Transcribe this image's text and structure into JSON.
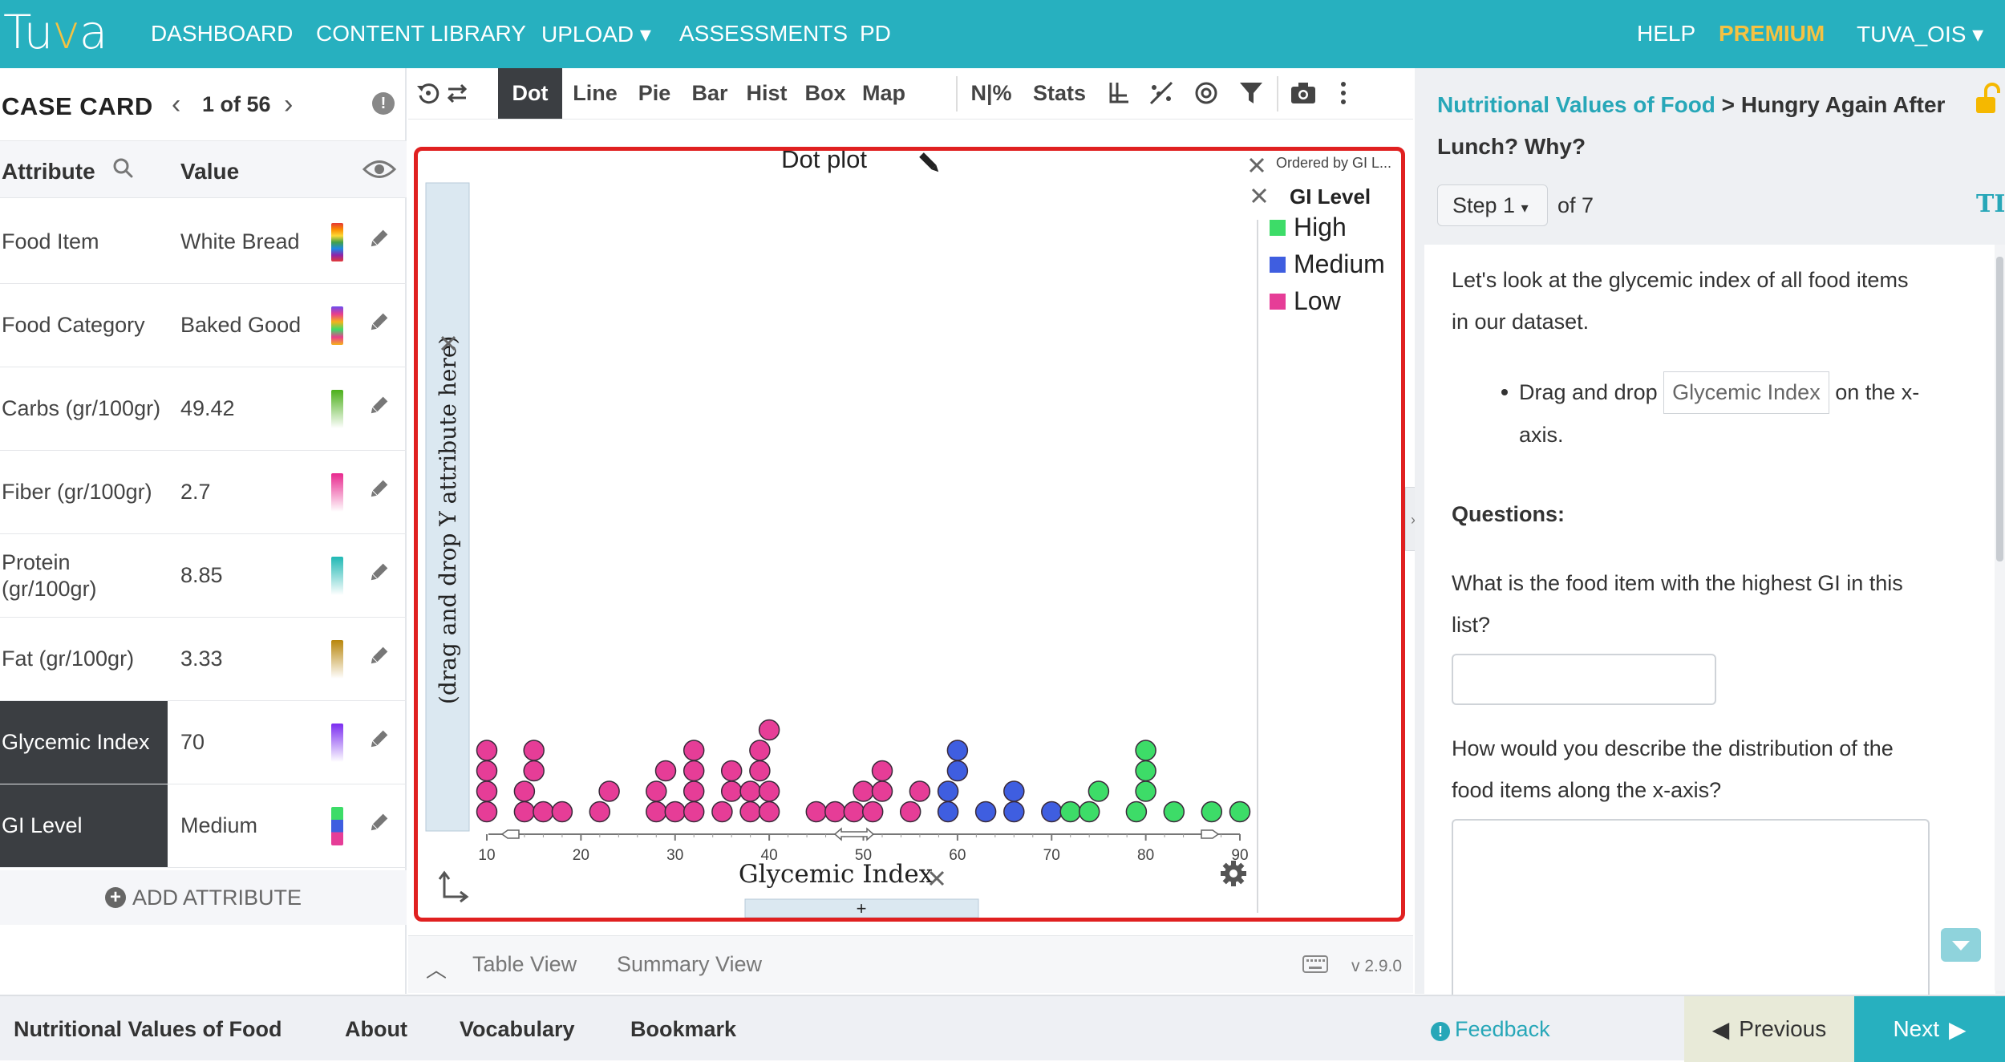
{
  "logo": {
    "text_a": "Tu",
    "text_b": "v",
    "text_c": "a"
  },
  "nav": {
    "dashboard": "DASHBOARD",
    "content_library": "CONTENT LIBRARY",
    "upload": "UPLOAD ▾",
    "assessments": "ASSESSMENTS",
    "pd": "PD",
    "help": "HELP",
    "premium": "PREMIUM",
    "user": "TUVA_OIS ▾"
  },
  "case_card": {
    "title": "CASE CARD",
    "page": "1 of 56",
    "col_attribute": "Attribute",
    "col_value": "Value",
    "add_attribute": "ADD ATTRIBUTE",
    "rows": [
      {
        "name": "Food Item",
        "value": "White Bread",
        "swatch": "rainbow",
        "active": false
      },
      {
        "name": "Food Category",
        "value": "Baked Good",
        "swatch": "category",
        "active": false
      },
      {
        "name": "Carbs (gr/100gr)",
        "value": "49.42",
        "swatch": "#4caf1a",
        "active": false
      },
      {
        "name": "Fiber (gr/100gr)",
        "value": "2.7",
        "swatch": "#e8288e",
        "active": false
      },
      {
        "name": "Protein (gr/100gr)",
        "value": "8.85",
        "swatch": "#1fb8b4",
        "active": false
      },
      {
        "name": "Fat (gr/100gr)",
        "value": "3.33",
        "swatch": "#b8860b",
        "active": false
      },
      {
        "name": "Glycemic Index",
        "value": "70",
        "swatch": "#7b2cf0",
        "active": true
      },
      {
        "name": "GI Level",
        "value": "Medium",
        "swatch": "gi",
        "active": true
      }
    ]
  },
  "toolbar": {
    "dot": "Dot",
    "line": "Line",
    "pie": "Pie",
    "bar": "Bar",
    "hist": "Hist",
    "box": "Box",
    "map": "Map",
    "npct": "N|%",
    "stats": "Stats"
  },
  "graph": {
    "title": "Dot plot",
    "y_placeholder": "(drag and drop Y attribute here)",
    "x_label": "Glycemic Index",
    "ordered_by": "Ordered by GI L...",
    "legend_title": "GI Level",
    "add_x": "+"
  },
  "chart_data": {
    "type": "scatter",
    "title": "Dot plot",
    "xlabel": "Glycemic Index",
    "ylabel": "",
    "xlim": [
      10,
      90
    ],
    "x_ticks": [
      "10",
      "20",
      "30",
      "40",
      "50",
      "60",
      "70",
      "80",
      "90"
    ],
    "legend": [
      {
        "name": "High",
        "color": "#3ddc68"
      },
      {
        "name": "Medium",
        "color": "#3f5ee0"
      },
      {
        "name": "Low",
        "color": "#e63d97"
      }
    ],
    "series": [
      {
        "name": "Low",
        "color": "#e63d97",
        "values": [
          10,
          10,
          10,
          10,
          14,
          14,
          15,
          15,
          16,
          18,
          22,
          23,
          28,
          28,
          29,
          30,
          32,
          32,
          32,
          32,
          35,
          36,
          36,
          38,
          38,
          39,
          39,
          40,
          40,
          40,
          45,
          47,
          49,
          50,
          51,
          52,
          52,
          55,
          56
        ]
      },
      {
        "name": "Medium",
        "color": "#3f5ee0",
        "values": [
          59,
          59,
          60,
          60,
          63,
          66,
          66,
          70
        ]
      },
      {
        "name": "High",
        "color": "#3ddc68",
        "values": [
          72,
          74,
          75,
          79,
          80,
          80,
          80,
          83,
          87,
          90
        ]
      }
    ]
  },
  "graph_footer": {
    "table_view": "Table View",
    "summary_view": "Summary View",
    "version": "v 2.9.0"
  },
  "panel": {
    "crumb_link": "Nutritional Values of Food",
    "crumb_sep": " > ",
    "crumb_current": "Hungry Again After Lunch? Why?",
    "step": "Step 1",
    "of": "of 7",
    "intro": "Let's look at the glycemic index of all food items in our dataset.",
    "bullet_pre": "Drag and drop",
    "bullet_chip": "Glycemic Index",
    "bullet_post": "on the x-axis.",
    "questions_label": "Questions:",
    "q1": "What is the food item with the highest GI in this list?",
    "q2": "How would you describe the distribution of the food items along the x-axis?"
  },
  "bottom": {
    "dataset": "Nutritional Values of Food",
    "about": "About",
    "vocabulary": "Vocabulary",
    "bookmark": "Bookmark",
    "feedback": "Feedback",
    "previous": "Previous",
    "next": "Next"
  }
}
